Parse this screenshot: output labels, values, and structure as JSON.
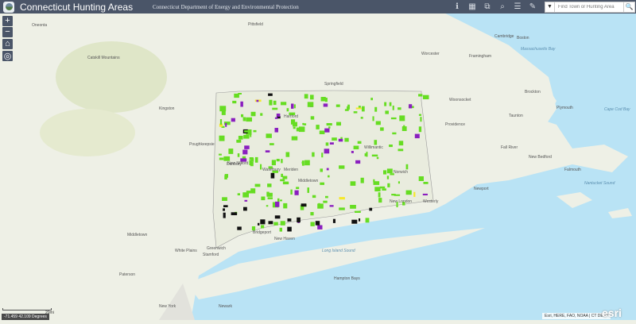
{
  "header": {
    "title": "Connecticut Hunting Areas",
    "subtitle": "Connecticut Department of Energy and Environmental Protection",
    "tools": [
      {
        "icon": "info-icon",
        "glyph": "ℹ"
      },
      {
        "icon": "basemap-gallery-icon",
        "glyph": "▦"
      },
      {
        "icon": "layers-icon",
        "glyph": "⧉"
      },
      {
        "icon": "query-icon",
        "glyph": "⌕"
      },
      {
        "icon": "legend-icon",
        "glyph": "☰"
      },
      {
        "icon": "measure-icon",
        "glyph": "✎"
      }
    ],
    "search": {
      "placeholder": "Find Town or Hunting Area",
      "dropdown": "▼",
      "button": "🔍"
    }
  },
  "map_controls": {
    "zoom_in": "+",
    "zoom_out": "−",
    "home": "⌂",
    "locate": "◎"
  },
  "scale": "20mi",
  "coordinates": "-71.459 42.109 Degrees",
  "attribution": "Esri, HERE, FAO, NOAA | CT DEEP",
  "esri_logo": "esri",
  "colors": {
    "header": "#4a5568",
    "land": "#eef0e6",
    "water": "#b9e3f5",
    "hunting_green": "#66dd22",
    "purple": "#8a1fbf",
    "yellow": "#f5e82a",
    "black": "#111111"
  },
  "places": [
    {
      "name": "Pittsfield",
      "t": "lbl"
    },
    {
      "name": "Springfield",
      "t": "lbl"
    },
    {
      "name": "Worcester",
      "t": "lbl"
    },
    {
      "name": "Boston",
      "t": "lbl"
    },
    {
      "name": "Cambridge",
      "t": "lbl"
    },
    {
      "name": "Framingham",
      "t": "lbl"
    },
    {
      "name": "Hartford",
      "t": "lbl"
    },
    {
      "name": "New Haven",
      "t": "lbl"
    },
    {
      "name": "Providence",
      "t": "lbl"
    },
    {
      "name": "Kingston",
      "t": "lbl"
    },
    {
      "name": "Poughkeepsie",
      "t": "lbl"
    },
    {
      "name": "Danbury",
      "t": "lbl"
    },
    {
      "name": "Waterbury",
      "t": "lbl"
    },
    {
      "name": "Meriden",
      "t": "lbl"
    },
    {
      "name": "Middletown",
      "t": "lbl"
    },
    {
      "name": "Bridgeport",
      "t": "lbl"
    },
    {
      "name": "Stamford",
      "t": "lbl"
    },
    {
      "name": "Greenwich",
      "t": "lbl"
    },
    {
      "name": "Norwich",
      "t": "lbl"
    },
    {
      "name": "New London",
      "t": "lbl"
    },
    {
      "name": "Willimantic",
      "t": "lbl"
    },
    {
      "name": "Woonsocket",
      "t": "lbl"
    },
    {
      "name": "Brockton",
      "t": "lbl"
    },
    {
      "name": "Taunton",
      "t": "lbl"
    },
    {
      "name": "Fall River",
      "t": "lbl"
    },
    {
      "name": "New Bedford",
      "t": "lbl"
    },
    {
      "name": "Plymouth",
      "t": "lbl"
    },
    {
      "name": "Falmouth",
      "t": "lbl"
    },
    {
      "name": "Newport",
      "t": "lbl"
    },
    {
      "name": "Westerly",
      "t": "lbl"
    },
    {
      "name": "New Milford",
      "t": "lbl"
    },
    {
      "name": "Middletown",
      "t": "lbl"
    },
    {
      "name": "White Plains",
      "t": "lbl"
    },
    {
      "name": "Paterson",
      "t": "lbl"
    },
    {
      "name": "New York",
      "t": "lbl"
    },
    {
      "name": "Newark",
      "t": "lbl"
    },
    {
      "name": "Hampton Bays",
      "t": "lbl"
    },
    {
      "name": "Oneonta",
      "t": "lbl"
    },
    {
      "name": "Catskill Mountains",
      "t": "lbl"
    },
    {
      "name": "Long Island Sound",
      "t": "water"
    },
    {
      "name": "Massachusetts Bay",
      "t": "water"
    },
    {
      "name": "Cape Cod Bay",
      "t": "water"
    },
    {
      "name": "Nantucket Sound",
      "t": "water"
    }
  ]
}
